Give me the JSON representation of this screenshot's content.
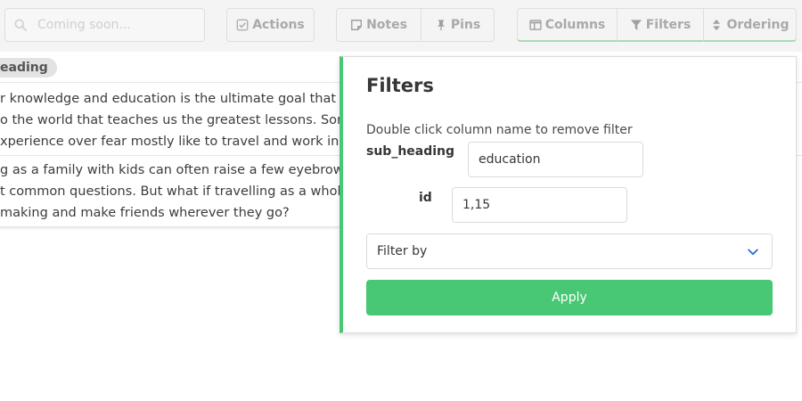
{
  "toolbar": {
    "search_placeholder": "Coming soon...",
    "actions_label": "Actions",
    "notes_label": "Notes",
    "pins_label": "Pins",
    "columns_label": "Columns",
    "filters_label": "Filters",
    "ordering_label": "Ordering"
  },
  "table": {
    "column_header": "eading",
    "rows": [
      {
        "lines": [
          "r knowledge and education is the ultimate goal that true g",
          "o the world that teaches us the greatest lessons. Sometim",
          "xperience over fear mostly like to travel and work instead"
        ]
      },
      {
        "lines": [
          "g as a family with kids can often raise a few eyebrows- \"W",
          "t common questions. But what if travelling as a whole fam",
          "making and make friends wherever they go?"
        ]
      }
    ]
  },
  "filters_panel": {
    "title": "Filters",
    "hint": "Double click column name to remove filter",
    "filters": [
      {
        "column": "sub_heading",
        "value": "education"
      },
      {
        "column": "id",
        "value": "1,15"
      }
    ],
    "filter_by_placeholder": "Filter by",
    "apply_label": "Apply"
  },
  "colors": {
    "accent_green": "#48c774",
    "toolbar_bg": "#f4f4f4"
  }
}
